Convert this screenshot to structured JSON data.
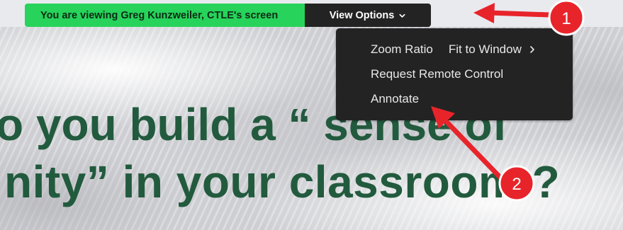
{
  "banner": {
    "status_text": "You are viewing Greg Kunzweiler, CTLE's screen",
    "view_options_label": "View Options",
    "status_color": "#27d35a"
  },
  "menu": {
    "items": [
      {
        "label": "Zoom Ratio",
        "value": "Fit to Window",
        "icon": "chevron-right-icon"
      },
      {
        "label": "Request Remote Control"
      },
      {
        "label": "Annotate"
      }
    ]
  },
  "slide": {
    "line1": "o you build a “ sense of",
    "line2": "nity” in your  classroom ?",
    "text_color": "#225a3e"
  },
  "annotations": {
    "callout_1": "1",
    "callout_2": "2",
    "arrow_color": "#e8242b"
  }
}
